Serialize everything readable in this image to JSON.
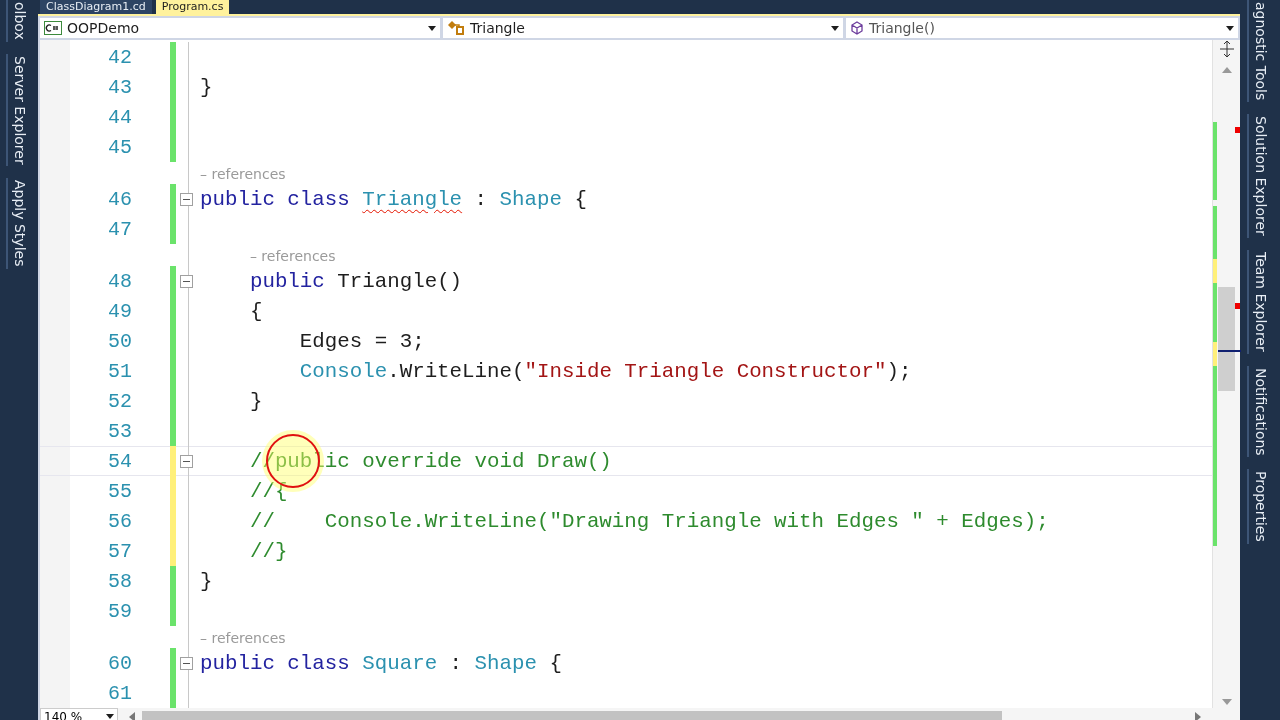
{
  "tabs": [
    {
      "label": "ClassDiagram1.cd",
      "selected": false
    },
    {
      "label": "Program.cs",
      "selected": true
    }
  ],
  "navigation": [
    {
      "kind": "project",
      "text": "OOPDemo"
    },
    {
      "kind": "class",
      "text": "Triangle"
    },
    {
      "kind": "method",
      "text": "Triangle()"
    }
  ],
  "left_dock": [
    "olbox",
    "Server Explorer",
    "Apply Styles"
  ],
  "right_dock": [
    "agnostic Tools",
    "Solution Explorer",
    "Team Explorer",
    "Notifications",
    "Properties"
  ],
  "lines": [
    {
      "kind": "code",
      "number": "42",
      "unsaved": false
    },
    {
      "kind": "code",
      "number": "43",
      "unsaved": false,
      "tokens": [
        {
          "color": "#1e1e1e",
          "text": "}"
        }
      ]
    },
    {
      "kind": "code",
      "number": "44",
      "unsaved": false
    },
    {
      "kind": "code",
      "number": "45",
      "unsaved": false
    },
    {
      "kind": "codelens",
      "text": "– references"
    },
    {
      "kind": "code",
      "number": "46",
      "unsaved": false,
      "fold": true,
      "tokens": [
        {
          "color": "#2323a0",
          "text": "public class "
        },
        {
          "color": "#2b91af",
          "text": "Triangle",
          "error": true
        },
        {
          "color": "#1e1e1e",
          "text": " : "
        },
        {
          "color": "#2b91af",
          "text": "Shape"
        },
        {
          "color": "#1e1e1e",
          "text": " {"
        }
      ]
    },
    {
      "kind": "code",
      "number": "47",
      "unsaved": false
    },
    {
      "kind": "codelens",
      "text": "    – references"
    },
    {
      "kind": "code",
      "number": "48",
      "unsaved": false,
      "fold": true,
      "tokens": [
        {
          "color": "#2323a0",
          "text": "    public "
        },
        {
          "color": "#1e1e1e",
          "text": "Triangle()"
        }
      ]
    },
    {
      "kind": "code",
      "number": "49",
      "unsaved": false,
      "tokens": [
        {
          "color": "#1e1e1e",
          "text": "    {"
        }
      ]
    },
    {
      "kind": "code",
      "number": "50",
      "unsaved": false,
      "tokens": [
        {
          "color": "#1e1e1e",
          "text": "        Edges = 3;"
        }
      ]
    },
    {
      "kind": "code",
      "number": "51",
      "unsaved": false,
      "tokens": [
        {
          "color": "#2b91af",
          "text": "        Console"
        },
        {
          "color": "#1e1e1e",
          "text": ".WriteLine("
        },
        {
          "color": "#a31515",
          "text": "\"Inside Triangle Constructor\""
        },
        {
          "color": "#1e1e1e",
          "text": ");"
        }
      ]
    },
    {
      "kind": "code",
      "number": "52",
      "unsaved": false,
      "tokens": [
        {
          "color": "#1e1e1e",
          "text": "    }"
        }
      ]
    },
    {
      "kind": "code",
      "number": "53",
      "unsaved": false
    },
    {
      "kind": "code",
      "number": "54",
      "unsaved": true,
      "fold": true,
      "current": true,
      "tokens": [
        {
          "color": "#2e8b2e",
          "text": "    //public override void Draw()"
        }
      ]
    },
    {
      "kind": "code",
      "number": "55",
      "unsaved": true,
      "tokens": [
        {
          "color": "#2e8b2e",
          "text": "    //{"
        }
      ]
    },
    {
      "kind": "code",
      "number": "56",
      "unsaved": true,
      "tokens": [
        {
          "color": "#2e8b2e",
          "text": "    //    Console.WriteLine(\"Drawing Triangle with Edges \" + Edges);"
        }
      ]
    },
    {
      "kind": "code",
      "number": "57",
      "unsaved": true,
      "tokens": [
        {
          "color": "#2e8b2e",
          "text": "    //}"
        }
      ]
    },
    {
      "kind": "code",
      "number": "58",
      "unsaved": false,
      "tokens": [
        {
          "color": "#1e1e1e",
          "text": "}"
        }
      ]
    },
    {
      "kind": "code",
      "number": "59",
      "unsaved": false
    },
    {
      "kind": "codelens",
      "text": "– references"
    },
    {
      "kind": "code",
      "number": "60",
      "unsaved": false,
      "fold": true,
      "tokens": [
        {
          "color": "#2323a0",
          "text": "public class "
        },
        {
          "color": "#2b91af",
          "text": "Square"
        },
        {
          "color": "#1e1e1e",
          "text": " : "
        },
        {
          "color": "#2b91af",
          "text": "Shape"
        },
        {
          "color": "#1e1e1e",
          "text": " {"
        }
      ]
    },
    {
      "kind": "code",
      "number": "61",
      "unsaved": false
    }
  ],
  "zoom": "140 %"
}
